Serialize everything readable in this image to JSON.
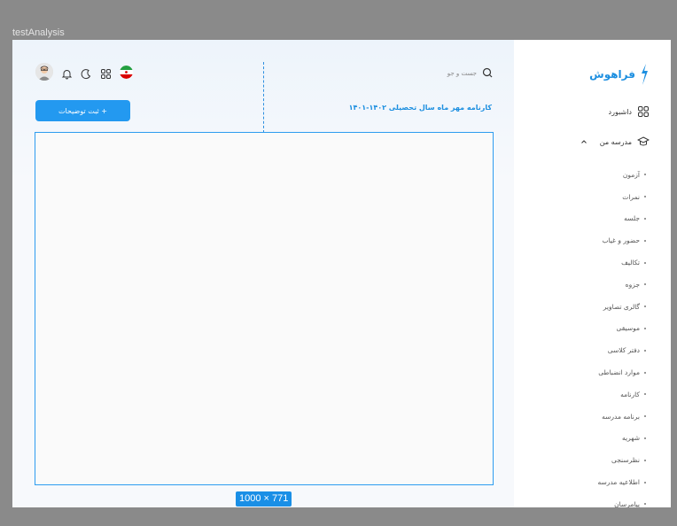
{
  "frame": {
    "label": "testAnalysis"
  },
  "logo": {
    "text": "فراهوش"
  },
  "sidebar": {
    "dashboard_label": "داشبورد",
    "my_school_label": "مدرسه من",
    "items": [
      "آزمون",
      "نمرات",
      "جلسه",
      "حضور و غیاب",
      "تکالیف",
      "جزوه",
      "گالری تصاویر",
      "موسیقی",
      "دفتر کلاسی",
      "موارد انضباطی",
      "کارنامه",
      "برنامه مدرسه",
      "شهریه",
      "نظرسنجی",
      "اطلاعیه مدرسه",
      "پیامرسان"
    ]
  },
  "search": {
    "placeholder": "جست و جو"
  },
  "header": {
    "report_title": "کارنامه مهر ماه سال تحصیلی ۱۴۰۲-۱۴۰۱",
    "add_button_label": "+ ثبت توضیحات"
  },
  "size_badge": "1000 × 771",
  "colors": {
    "accent": "#2399f0",
    "brand": "#1d8fe0"
  },
  "icons": [
    "logo-mark-icon",
    "dashboard-grid-icon",
    "school-cap-icon",
    "chevron-up-icon",
    "search-icon",
    "bell-icon",
    "moon-icon",
    "apps-icon",
    "iran-flag-icon",
    "avatar"
  ]
}
